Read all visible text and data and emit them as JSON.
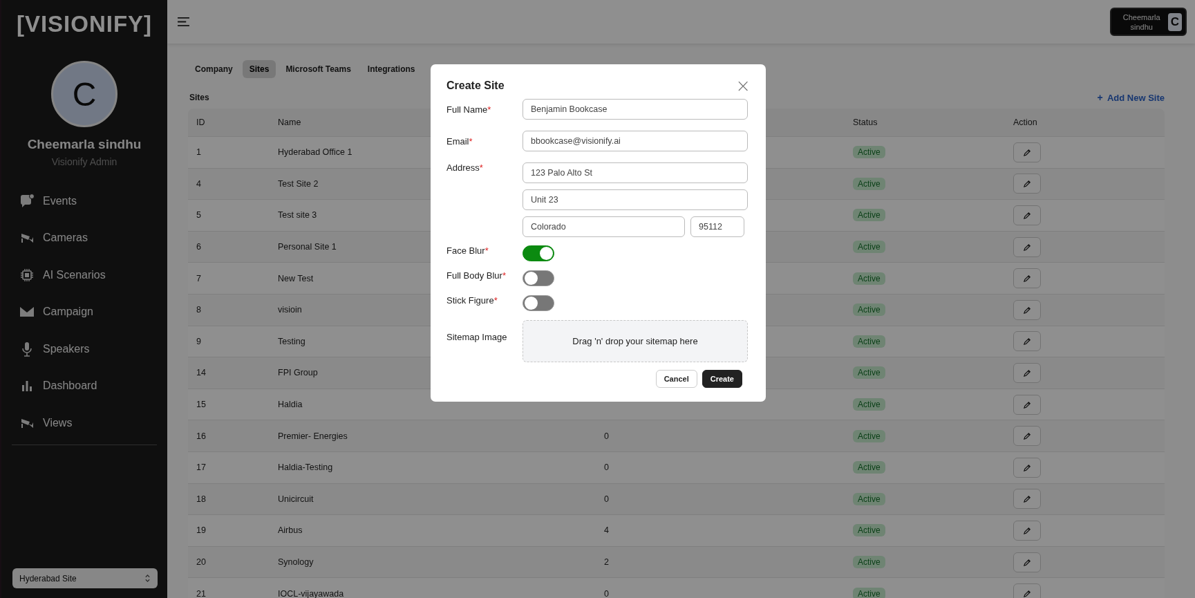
{
  "sidebar": {
    "logo": "[VISIONIFY]",
    "avatar_letter": "C",
    "user_name": "Cheemarla sindhu",
    "user_role": "Visionify Admin",
    "items": [
      {
        "label": "Events"
      },
      {
        "label": "Cameras"
      },
      {
        "label": "AI Scenarios"
      },
      {
        "label": "Campaign"
      },
      {
        "label": "Speakers"
      },
      {
        "label": "Dashboard"
      },
      {
        "label": "Views"
      }
    ],
    "site_select": {
      "value": "Hyderabad Site"
    }
  },
  "header": {
    "user_button": {
      "name": "Cheemarla sindhu",
      "letter": "C"
    }
  },
  "tabs": [
    {
      "label": "Company",
      "selected": false
    },
    {
      "label": "Sites",
      "selected": true
    },
    {
      "label": "Microsoft Teams",
      "selected": false
    },
    {
      "label": "Integrations",
      "selected": false
    }
  ],
  "section_title": "Sites",
  "add_button": {
    "icon": "+",
    "label": "Add New Site"
  },
  "table": {
    "columns": [
      "ID",
      "Name",
      "",
      "Status",
      "Action"
    ],
    "rows": [
      {
        "id": "1",
        "name": "Hyderabad Office 1",
        "status": "Active"
      },
      {
        "id": "4",
        "name": "Test Site 2",
        "status": "Active"
      },
      {
        "id": "5",
        "name": "Test site 3",
        "status": "Active"
      },
      {
        "id": "6",
        "name": "Personal Site 1",
        "status": "Active"
      },
      {
        "id": "7",
        "name": "New Test",
        "status": "Active"
      },
      {
        "id": "8",
        "name": "visioin",
        "status": "Active"
      },
      {
        "id": "9",
        "name": "Testing",
        "status": "Active"
      },
      {
        "id": "14",
        "name": "FPI Group",
        "status": "Active"
      },
      {
        "id": "15",
        "name": "Haldia",
        "status": "Active"
      },
      {
        "id": "16",
        "name": "Premier- Energies",
        "column_3": "0",
        "status": "Active"
      },
      {
        "id": "17",
        "name": "Haldia-Testing",
        "column_3": "0",
        "status": "Active"
      },
      {
        "id": "18",
        "name": "Unicircuit",
        "column_3": "0",
        "status": "Active"
      },
      {
        "id": "19",
        "name": "Airbus",
        "column_3": "4",
        "status": "Active"
      },
      {
        "id": "20",
        "name": "Synology",
        "column_3": "2",
        "status": "Active"
      },
      {
        "id": "21",
        "name": "IOCL-vijayawada",
        "column_3": "0",
        "status": "Active"
      }
    ]
  },
  "dialog": {
    "title": "Create Site",
    "close": "×",
    "fields": [
      {
        "label": "Full Name",
        "mark": "*",
        "kind": "text",
        "values": [
          "Benjamin Bookcase"
        ]
      },
      {
        "label": "Email",
        "mark": "*",
        "kind": "text",
        "values": [
          "bbookcase@visionify.ai"
        ]
      },
      {
        "label": "Address",
        "mark": "*",
        "kind": "address",
        "values": [
          "123 Palo Alto St",
          "Unit 23",
          "Colorado",
          "95112"
        ]
      },
      {
        "label": "Face Blur",
        "mark": "*",
        "kind": "toggle",
        "on": true
      },
      {
        "label": "Full Body Blur",
        "mark": "*",
        "kind": "toggle",
        "on": false
      },
      {
        "label": "Stick Figure",
        "mark": "*",
        "kind": "toggle",
        "on": false
      },
      {
        "label": "Sitemap Image",
        "kind": "dropzone",
        "text": "Drag 'n' drop your sitemap here"
      }
    ],
    "buttons": [
      {
        "label": "Cancel",
        "kind": "secondary"
      },
      {
        "label": "Create",
        "kind": "primary"
      }
    ]
  }
}
